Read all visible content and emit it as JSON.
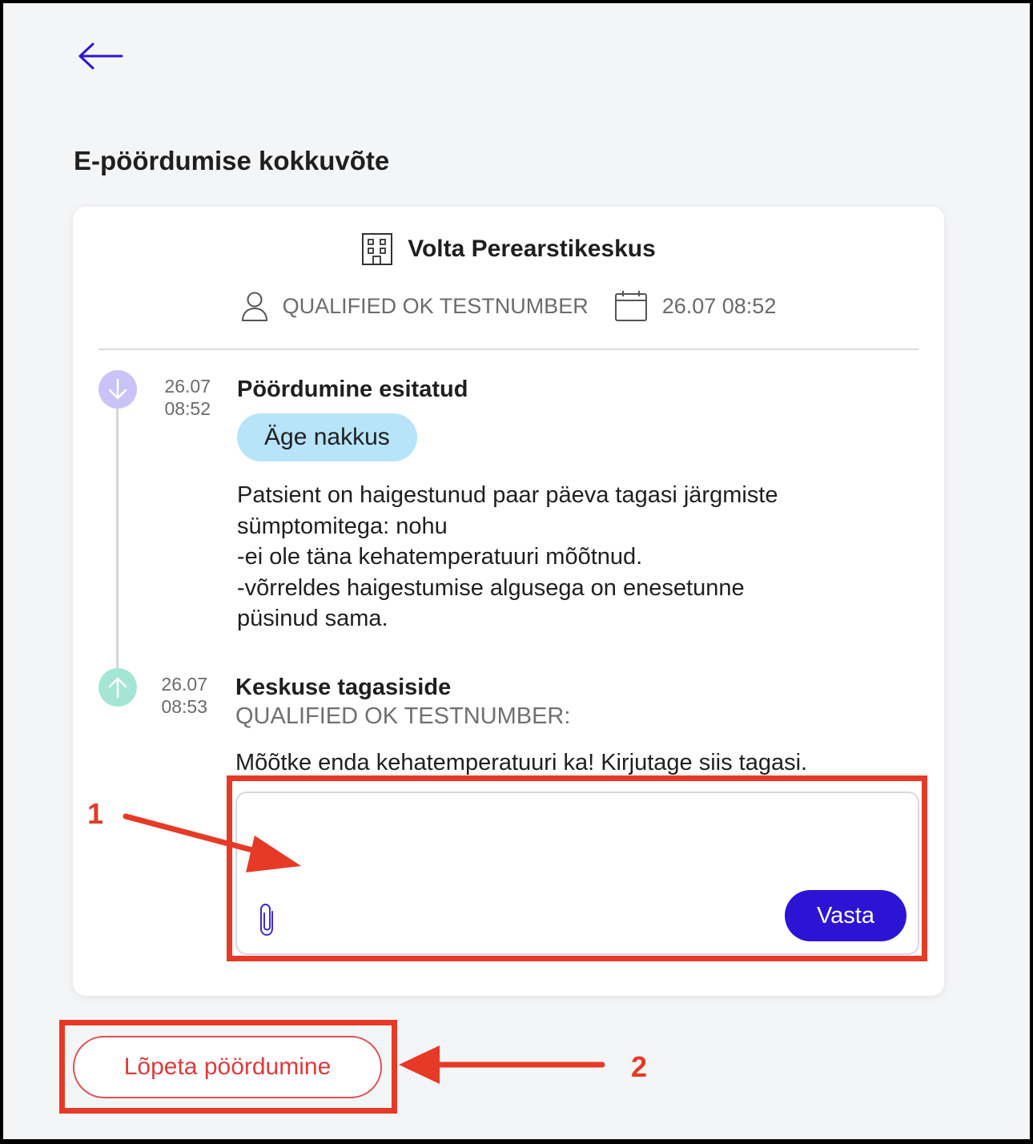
{
  "header": {
    "back_icon": "arrow-left-icon",
    "title": "E-pöördumise kokkuvõte"
  },
  "summary": {
    "clinic_icon": "building-icon",
    "clinic_name": "Volta Perearstikeskus",
    "patient_icon": "person-icon",
    "patient_name": "QUALIFIED OK TESTNUMBER",
    "date_icon": "calendar-icon",
    "datetime": "26.07 08:52"
  },
  "timeline": [
    {
      "icon": "arrow-down-icon",
      "date": "26.07",
      "time": "08:52",
      "title": "Pöördumine esitatud",
      "tag": "Äge nakkus",
      "message": "Patsient on haigestunud paar päeva tagasi järgmiste\nsümptomitega: nohu\n-ei ole täna kehatemperatuuri mõõtnud.\n-võrreldes haigestumise algusega on enesetunne\npüsinud sama."
    },
    {
      "icon": "arrow-up-icon",
      "date": "26.07",
      "time": "08:53",
      "title": "Keskuse tagasiside",
      "sender": "QUALIFIED OK TESTNUMBER:",
      "message": "Mõõtke enda kehatemperatuuri ka! Kirjutage siis tagasi."
    }
  ],
  "reply": {
    "placeholder": "",
    "attach_icon": "paperclip-icon",
    "send_label": "Vasta"
  },
  "end_button": "Lõpeta pöördumine",
  "annotations": {
    "marker_1": "1",
    "marker_2": "2"
  },
  "colors": {
    "accent": "#2d14d4",
    "danger": "#e03a3a",
    "tag_bg": "#b8e4fa",
    "annotation": "#e63a26"
  }
}
